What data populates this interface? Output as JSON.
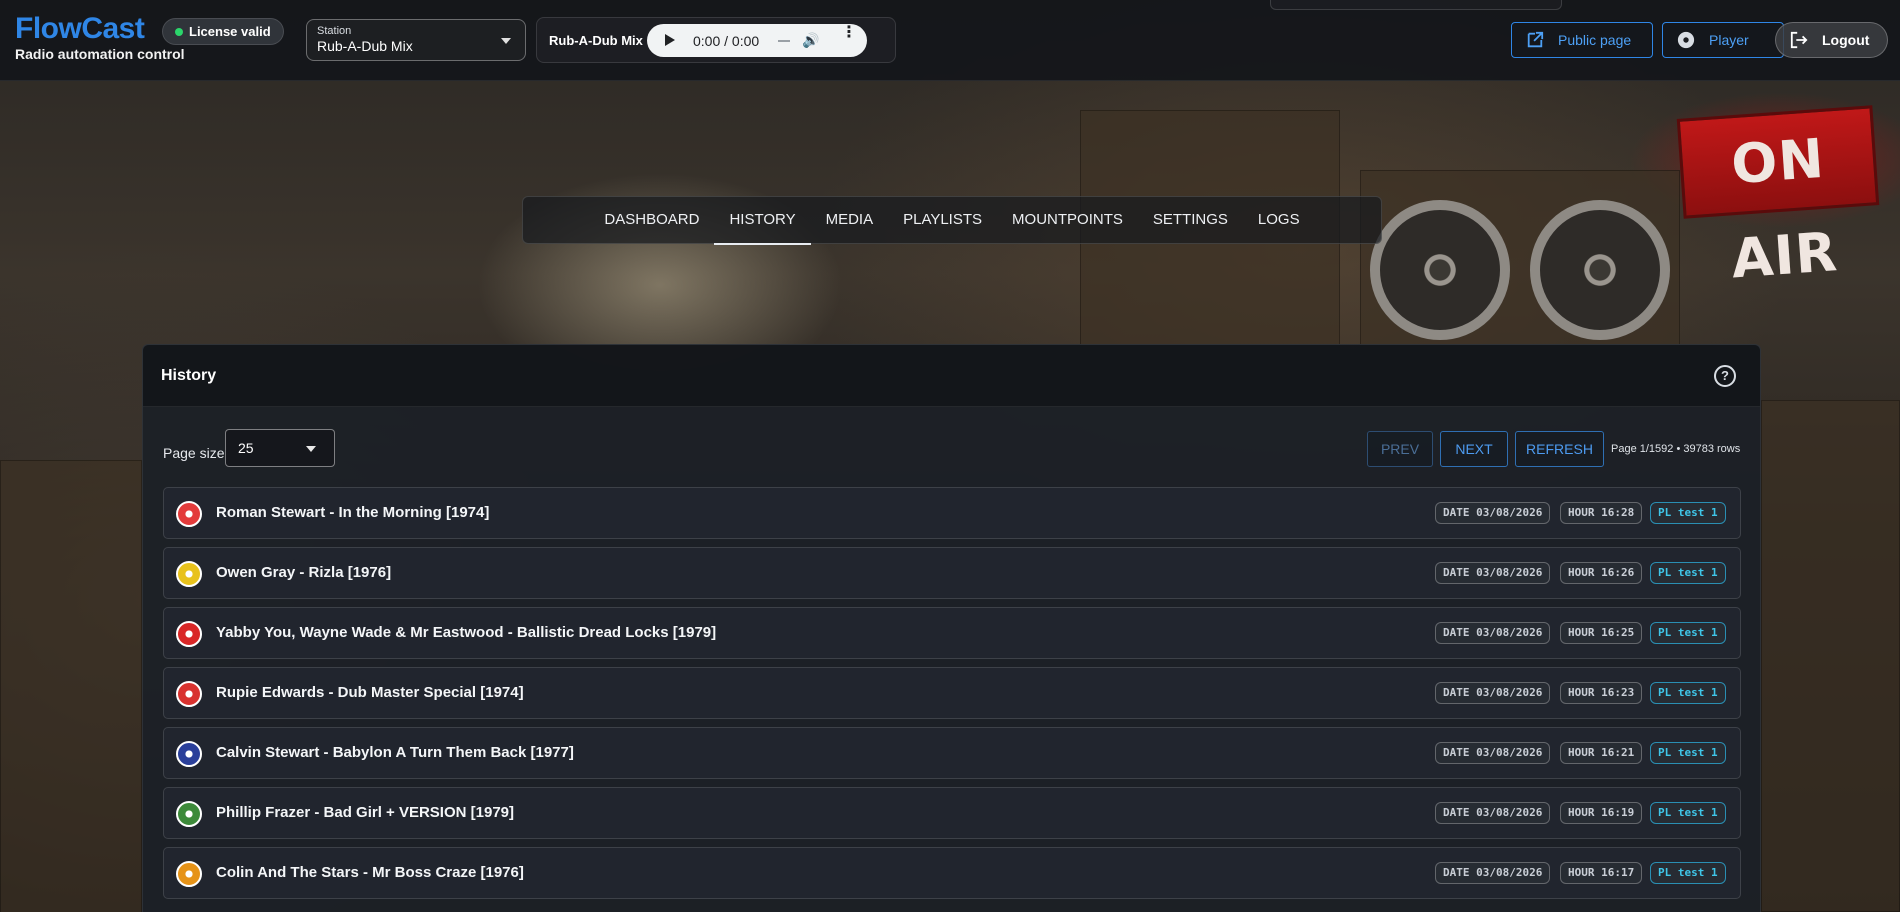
{
  "brand": {
    "name": "FlowCast",
    "subtitle": "Radio automation control"
  },
  "license": {
    "label": "License valid",
    "status_color": "#2bd66b"
  },
  "station": {
    "label": "Station",
    "value": "Rub-A-Dub Mix"
  },
  "player": {
    "title": "Rub-A-Dub Mix",
    "time": "0:00 / 0:00"
  },
  "top_buttons": {
    "public": "Public page",
    "player": "Player",
    "logout": "Logout"
  },
  "background": {
    "sign": "ON AIR"
  },
  "nav": {
    "tabs": [
      {
        "label": "DASHBOARD",
        "active": false
      },
      {
        "label": "HISTORY",
        "active": true
      },
      {
        "label": "MEDIA",
        "active": false
      },
      {
        "label": "PLAYLISTS",
        "active": false
      },
      {
        "label": "MOUNTPOINTS",
        "active": false
      },
      {
        "label": "SETTINGS",
        "active": false
      },
      {
        "label": "LOGS",
        "active": false
      }
    ]
  },
  "history": {
    "title": "History",
    "page_size_label": "Page size",
    "page_size_value": "25",
    "prev_label": "PREV",
    "next_label": "NEXT",
    "refresh_label": "REFRESH",
    "page_info": "Page 1/1592 • 39783 rows",
    "rows": [
      {
        "title": "Roman Stewart - In the Morning [1974]",
        "date": "DATE 03/08/2026",
        "hour": "HOUR 16:28",
        "playlist": "PL test 1",
        "avatar_color": "#e33b3b"
      },
      {
        "title": "Owen Gray - Rizla [1976]",
        "date": "DATE 03/08/2026",
        "hour": "HOUR 16:26",
        "playlist": "PL test 1",
        "avatar_color": "#e8c21c"
      },
      {
        "title": "Yabby You, Wayne Wade & Mr Eastwood - Ballistic Dread Locks [1979]",
        "date": "DATE 03/08/2026",
        "hour": "HOUR 16:25",
        "playlist": "PL test 1",
        "avatar_color": "#d92727"
      },
      {
        "title": "Rupie Edwards - Dub Master Special [1974]",
        "date": "DATE 03/08/2026",
        "hour": "HOUR 16:23",
        "playlist": "PL test 1",
        "avatar_color": "#d8322f"
      },
      {
        "title": "Calvin Stewart - Babylon A Turn Them Back [1977]",
        "date": "DATE 03/08/2026",
        "hour": "HOUR 16:21",
        "playlist": "PL test 1",
        "avatar_color": "#2a3f9a"
      },
      {
        "title": "Phillip Frazer - Bad Girl + VERSION [1979]",
        "date": "DATE 03/08/2026",
        "hour": "HOUR 16:19",
        "playlist": "PL test 1",
        "avatar_color": "#3d8a3a"
      },
      {
        "title": "Colin And The Stars - Mr Boss Craze [1976]",
        "date": "DATE 03/08/2026",
        "hour": "HOUR 16:17",
        "playlist": "PL test 1",
        "avatar_color": "#e69318"
      }
    ]
  }
}
